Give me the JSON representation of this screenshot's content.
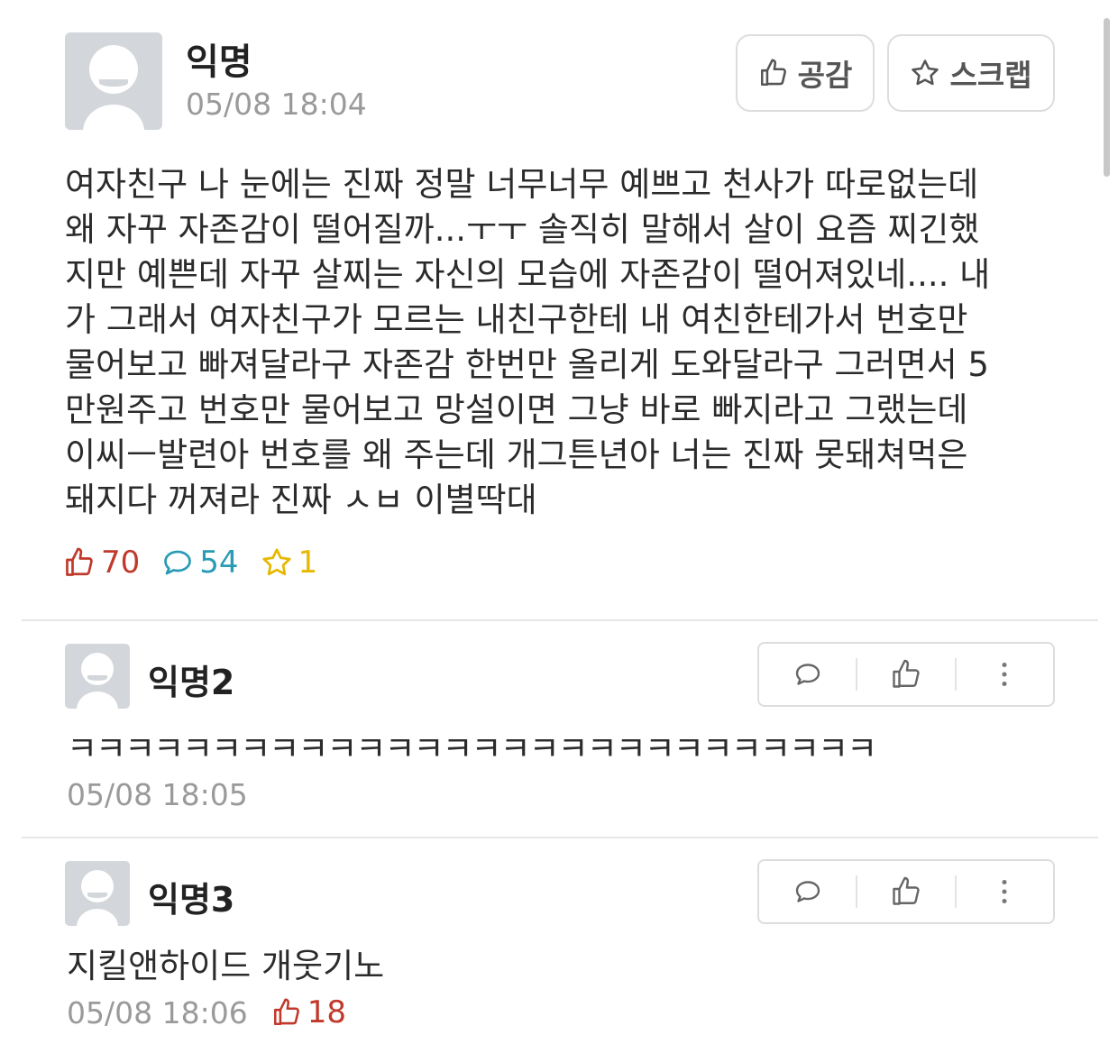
{
  "post": {
    "author": "익명",
    "time": "05/08 18:04",
    "like_button": "공감",
    "scrap_button": "스크랩",
    "body_lines": [
      "여자친구 나 눈에는 진짜 정말 너무너무 예쁘고 천사가 따로없는데",
      "왜 자꾸 자존감이 떨어질까...ㅜㅜ 솔직히 말해서 살이 요즘 찌긴했",
      "지만 예쁜데 자꾸 살찌는 자신의 모습에 자존감이 떨어져있네.... 내",
      "가 그래서 여자친구가 모르는 내친구한테 내 여친한테가서 번호만",
      "물어보고 빠져달라구 자존감 한번만 올리게 도와달라구 그러면서 5",
      "만원주고 번호만 물어보고 망설이면 그냥 바로 빠지라고 그랬는데",
      "이씨ㅡ발련아 번호를 왜 주는데 개그튼년아 너는 진짜 못돼쳐먹은",
      "돼지다 꺼져라 진짜 ㅅㅂ 이별딱대"
    ],
    "stats": {
      "likes": "70",
      "comments": "54",
      "scraps": "1"
    }
  },
  "comments": [
    {
      "author": "익명2",
      "text": "ㅋㅋㅋㅋㅋㅋㅋㅋㅋㅋㅋㅋㅋㅋㅋㅋㅋㅋㅋㅋㅋㅋㅋㅋㅋㅋㅋㅋ",
      "time": "05/08 18:05",
      "likes": ""
    },
    {
      "author": "익명3",
      "text": "지킬앤하이드 개웃기노",
      "time": "05/08 18:06",
      "likes": "18"
    }
  ],
  "colors": {
    "like": "#c0392b",
    "comment": "#2a9bb5",
    "scrap": "#e6b800",
    "muted": "#9a9a9a"
  },
  "icons": {
    "like": "thumbs-up-icon",
    "comment": "speech-bubble-icon",
    "scrap": "star-icon",
    "more": "more-vertical-icon"
  }
}
